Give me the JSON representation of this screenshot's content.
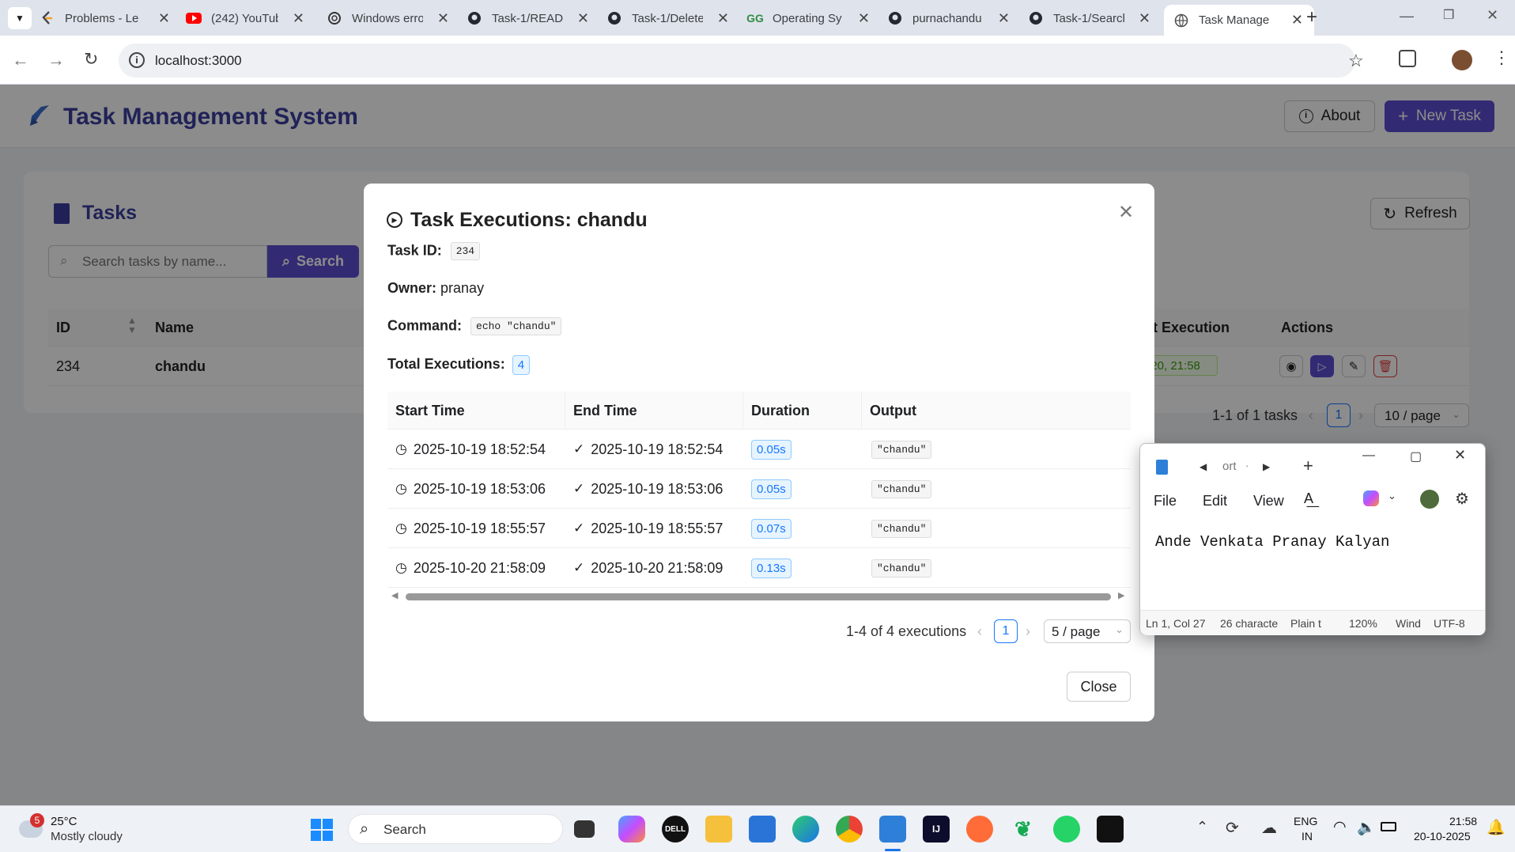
{
  "browser": {
    "tabs": [
      {
        "title": "Problems - Le",
        "icon": "leetcode-icon"
      },
      {
        "title": "(242) YouTub",
        "icon": "youtube-icon"
      },
      {
        "title": "Windows erro",
        "icon": "openai-icon"
      },
      {
        "title": "Task-1/READ",
        "icon": "github-icon"
      },
      {
        "title": "Task-1/Delete",
        "icon": "github-icon"
      },
      {
        "title": "Operating Sy",
        "icon": "gfg-icon"
      },
      {
        "title": "purnachandu",
        "icon": "github-icon"
      },
      {
        "title": "Task-1/Search",
        "icon": "github-icon"
      },
      {
        "title": "Task Manage",
        "icon": "globe-icon"
      }
    ],
    "url": "localhost:3000"
  },
  "app": {
    "title": "Task Management System",
    "about": "About",
    "new_task": "New Task",
    "tasks_title": "Tasks",
    "refresh": "Refresh",
    "search_placeholder": "Search tasks by name...",
    "search_btn": "Search",
    "columns": {
      "id": "ID",
      "name": "Name",
      "last_exec": "t Execution",
      "actions": "Actions"
    },
    "row": {
      "id": "234",
      "name": "chandu",
      "last_exec": "t 20, 21:58"
    },
    "pagination": {
      "summary": "1-1 of 1 tasks",
      "page": "1",
      "per_page": "10 / page"
    }
  },
  "modal": {
    "title": "Task Executions: chandu",
    "task_id_label": "Task ID:",
    "task_id": "234",
    "owner_label": "Owner:",
    "owner": "pranay",
    "command_label": "Command:",
    "command": "echo \"chandu\"",
    "total_label": "Total Executions:",
    "total": "4",
    "columns": [
      "Start Time",
      "End Time",
      "Duration",
      "Output"
    ],
    "executions": [
      {
        "start": "2025-10-19 18:52:54",
        "end": "2025-10-19 18:52:54",
        "duration": "0.05s",
        "output": "\"chandu\""
      },
      {
        "start": "2025-10-19 18:53:06",
        "end": "2025-10-19 18:53:06",
        "duration": "0.05s",
        "output": "\"chandu\""
      },
      {
        "start": "2025-10-19 18:55:57",
        "end": "2025-10-19 18:55:57",
        "duration": "0.07s",
        "output": "\"chandu\""
      },
      {
        "start": "2025-10-20 21:58:09",
        "end": "2025-10-20 21:58:09",
        "duration": "0.13s",
        "output": "\"chandu\""
      }
    ],
    "pagination": {
      "summary": "1-4 of 4 executions",
      "page": "1",
      "per_page": "5 / page"
    },
    "close": "Close"
  },
  "notepad": {
    "tab_title": "ort",
    "menu": [
      "File",
      "Edit",
      "View"
    ],
    "text": "Ande Venkata Pranay Kalyan",
    "status": [
      "Ln 1, Col 27",
      "26 characte",
      "Plain t",
      "120%",
      "Wind",
      "UTF-8"
    ]
  },
  "taskbar": {
    "weather_temp": "25°C",
    "weather_desc": "Mostly cloudy",
    "weather_badge": "5",
    "search": "Search",
    "lang1": "ENG",
    "lang2": "IN",
    "time": "21:58",
    "date": "20-10-2025"
  },
  "colors": {
    "primary": "#5b4fd1",
    "danger": "#e63b3b",
    "tag_blue": "#1677ff"
  }
}
